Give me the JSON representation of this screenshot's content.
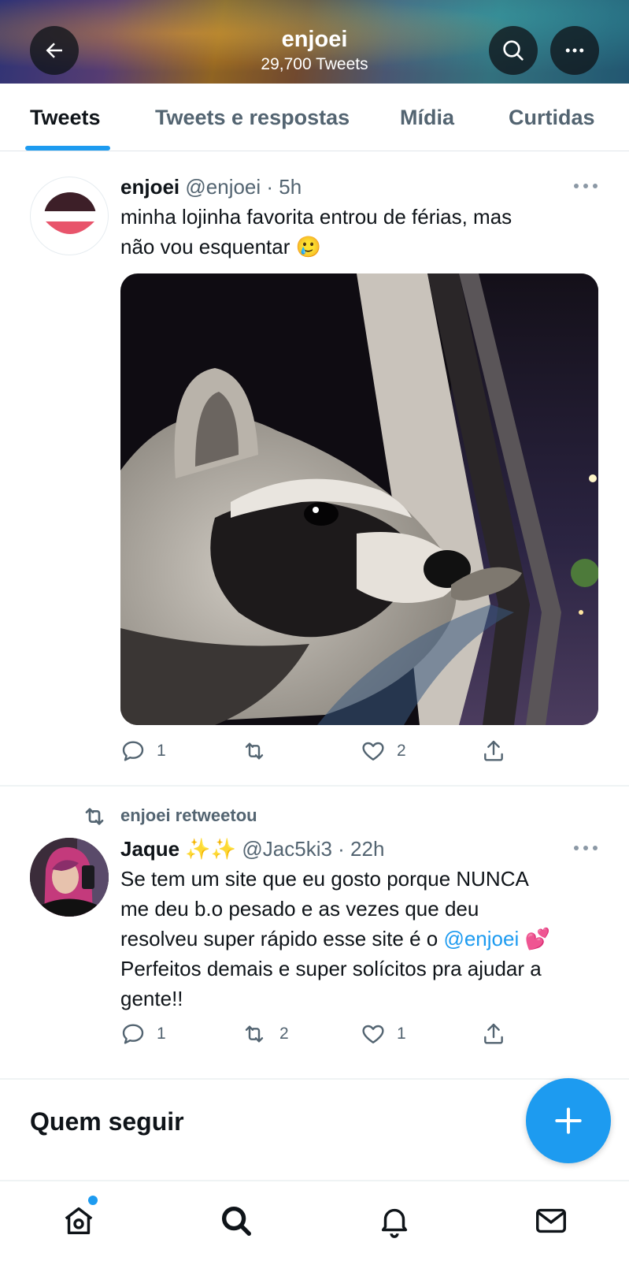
{
  "header": {
    "title": "enjoei",
    "tweet_count": "29,700 Tweets",
    "back_icon": "arrow-left-icon",
    "search_icon": "search-icon",
    "more_icon": "more-horizontal-icon"
  },
  "tabs": [
    {
      "label": "Tweets",
      "active": true
    },
    {
      "label": "Tweets e respostas",
      "active": false
    },
    {
      "label": "Mídia",
      "active": false
    },
    {
      "label": "Curtidas",
      "active": false
    }
  ],
  "tweets": [
    {
      "name": "enjoei",
      "handle": "@enjoei · 5h",
      "text_line1": "minha lojinha favorita entrou de férias, mas",
      "text_line2": "não vou esquentar",
      "emoji": "🥲",
      "media_description_icon": "raccoon-photo",
      "replies": "1",
      "retweets": "",
      "likes": "2"
    },
    {
      "retweeted_by": "enjoei retweetou",
      "name": "Jaque",
      "name_emoji": "✨✨",
      "handle": "@Jac5ki3 · 22h",
      "text_line1": "Se tem um site que eu gosto porque NUNCA",
      "text_line2": "me deu b.o pesado e as vezes que deu",
      "text_line3_pre": "resolveu super rápido esse site é o ",
      "text_line3_mention": "@enjoei",
      "text_line3_emoji": "💕",
      "text_line4": "Perfeitos demais e super solícitos pra ajudar a",
      "text_line5": "gente!!",
      "replies": "1",
      "retweets": "2",
      "likes": "1"
    }
  ],
  "who_to_follow": {
    "title": "Quem seguir"
  },
  "fab": {
    "icon": "plus-icon"
  },
  "bottom_nav": [
    {
      "icon": "home-icon",
      "has_notification_dot": true
    },
    {
      "icon": "search-icon"
    },
    {
      "icon": "bell-icon"
    },
    {
      "icon": "mail-icon"
    }
  ],
  "colors": {
    "accent": "#1d9bf0",
    "text": "#0f1419",
    "secondary": "#536471"
  }
}
